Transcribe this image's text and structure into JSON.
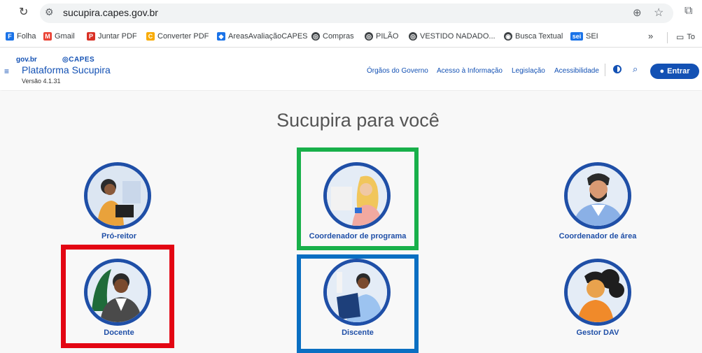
{
  "browser": {
    "url": "sucupira.capes.gov.br"
  },
  "bookmarks": [
    {
      "label": "Folha",
      "color": "#1a73e8"
    },
    {
      "label": "Gmail",
      "color": "#ea4335"
    },
    {
      "label": "Juntar PDF",
      "color": "#d93025"
    },
    {
      "label": "Converter PDF",
      "color": "#f9ab00"
    },
    {
      "label": "AreasAvaliaçãoCAPES",
      "color": "#1a73e8"
    },
    {
      "label": "Compras",
      "color": "#3c4043"
    },
    {
      "label": "PILÃO",
      "color": "#3c4043"
    },
    {
      "label": "VESTIDO NADADO...",
      "color": "#3c4043"
    },
    {
      "label": "Busca Textual",
      "color": "#3c4043"
    },
    {
      "label": "SEI",
      "color": "#1a73e8"
    }
  ],
  "bookmarks_more": "»",
  "bookmarks_folder": "To",
  "header": {
    "govbr": "gov.br",
    "capes": "CAPES",
    "platform": "Plataforma Sucupira",
    "version": "Versão 4.1.31",
    "links": [
      "Órgãos do Governo",
      "Acesso à Informação",
      "Legislação",
      "Acessibilidade"
    ],
    "login": "Entrar"
  },
  "main": {
    "title": "Sucupira para você",
    "profiles": [
      {
        "label": "Pró-reitor"
      },
      {
        "label": "Coordenador de programa"
      },
      {
        "label": "Coordenador de área"
      },
      {
        "label": "Docente"
      },
      {
        "label": "Discente"
      },
      {
        "label": "Gestor DAV"
      }
    ]
  },
  "highlights": {
    "green": "#18b04a",
    "red": "#e30613",
    "blue": "#0a6fc2"
  }
}
